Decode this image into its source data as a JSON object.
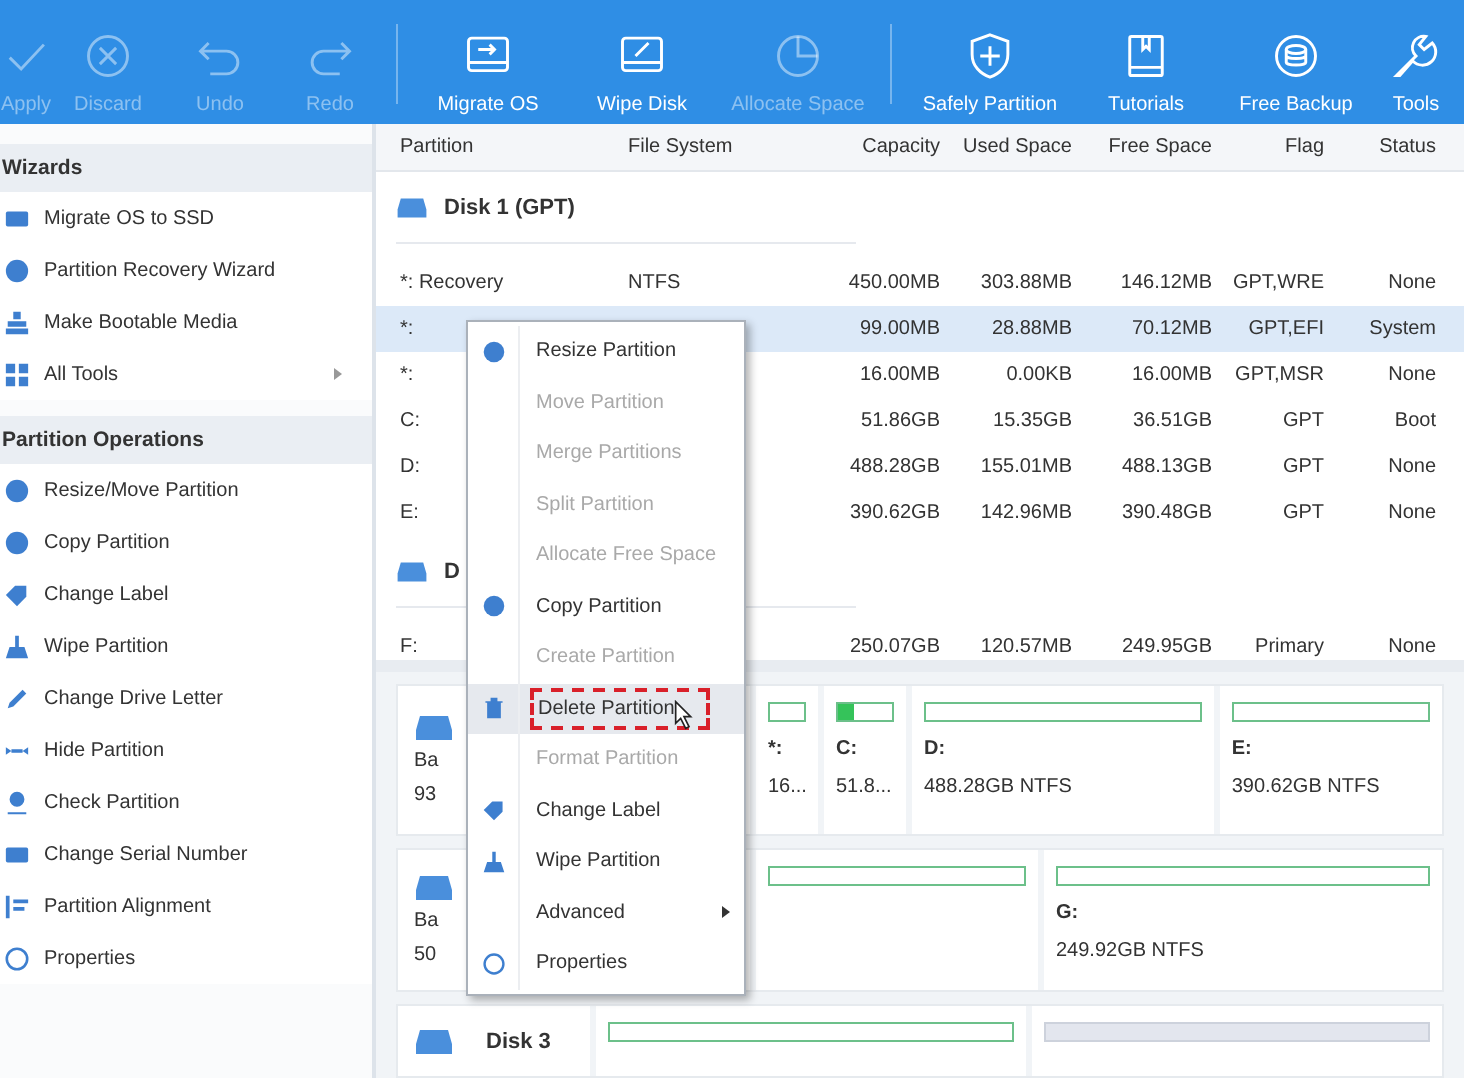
{
  "toolbar": [
    {
      "label": "Apply",
      "disabled": true
    },
    {
      "label": "Discard",
      "disabled": true
    },
    {
      "label": "Undo",
      "disabled": true
    },
    {
      "label": "Redo",
      "disabled": true
    },
    {
      "label": "Migrate OS",
      "disabled": false
    },
    {
      "label": "Wipe Disk",
      "disabled": false
    },
    {
      "label": "Allocate Space",
      "disabled": true
    },
    {
      "label": "Safely Partition",
      "disabled": false
    },
    {
      "label": "Tutorials",
      "disabled": false
    },
    {
      "label": "Free Backup",
      "disabled": false
    },
    {
      "label": "Tools",
      "disabled": false
    }
  ],
  "sidebar": [
    {
      "title": "Wizards",
      "items": [
        {
          "label": "Migrate OS to SSD",
          "submenu": false
        },
        {
          "label": "Partition Recovery Wizard",
          "submenu": false
        },
        {
          "label": "Make Bootable Media",
          "submenu": false
        },
        {
          "label": "All Tools",
          "submenu": true
        }
      ]
    },
    {
      "title": "Partition Operations",
      "items": [
        {
          "label": "Resize/Move Partition",
          "submenu": false
        },
        {
          "label": "Copy Partition",
          "submenu": false
        },
        {
          "label": "Change Label",
          "submenu": false
        },
        {
          "label": "Wipe Partition",
          "submenu": false
        },
        {
          "label": "Change Drive Letter",
          "submenu": false
        },
        {
          "label": "Hide Partition",
          "submenu": false
        },
        {
          "label": "Check Partition",
          "submenu": false
        },
        {
          "label": "Change Serial Number",
          "submenu": false
        },
        {
          "label": "Partition Alignment",
          "submenu": false
        },
        {
          "label": "Properties",
          "submenu": false
        }
      ]
    }
  ],
  "table": {
    "columns": [
      "Partition",
      "File System",
      "Capacity",
      "Used Space",
      "Free Space",
      "Flag",
      "Status"
    ],
    "disks": [
      {
        "title": "Disk 1 (GPT)",
        "rows": [
          {
            "cells": [
              "*: Recovery",
              "NTFS",
              "450.00MB",
              "303.88MB",
              "146.12MB",
              "GPT,WRE",
              "None"
            ],
            "selected": false
          },
          {
            "cells": [
              "*:",
              "",
              "99.00MB",
              "28.88MB",
              "70.12MB",
              "GPT,EFI",
              "System"
            ],
            "selected": true
          },
          {
            "cells": [
              "*:",
              "",
              "16.00MB",
              "0.00KB",
              "16.00MB",
              "GPT,MSR",
              "None"
            ],
            "selected": false
          },
          {
            "cells": [
              "C:",
              "",
              "51.86GB",
              "15.35GB",
              "36.51GB",
              "GPT",
              "Boot"
            ],
            "selected": false
          },
          {
            "cells": [
              "D:",
              "",
              "488.28GB",
              "155.01MB",
              "488.13GB",
              "GPT",
              "None"
            ],
            "selected": false
          },
          {
            "cells": [
              "E:",
              "",
              "390.62GB",
              "142.96MB",
              "390.48GB",
              "GPT",
              "None"
            ],
            "selected": false
          }
        ]
      },
      {
        "title": "D",
        "rows": [
          {
            "cells": [
              "F:",
              "",
              "250.07GB",
              "120.57MB",
              "249.95GB",
              "Primary",
              "None"
            ],
            "selected": false
          }
        ]
      }
    ]
  },
  "disk_map": [
    {
      "info": [
        "Ba",
        "93"
      ],
      "partitions": [
        {
          "label": "*:",
          "detail": "16...",
          "level": 0,
          "kind": "used"
        },
        {
          "label": "C:",
          "detail": "51.8...",
          "level": 0.3,
          "kind": "used"
        },
        {
          "label": "D:",
          "detail": "488.28GB NTFS",
          "level": 0,
          "kind": "used"
        },
        {
          "label": "E:",
          "detail": "390.62GB NTFS",
          "level": 0,
          "kind": "used"
        }
      ]
    },
    {
      "info": [
        "Ba",
        "50"
      ],
      "partitions": [
        {
          "level": 0,
          "kind": "used"
        },
        {
          "label": "G:",
          "detail": "249.92GB NTFS",
          "level": 0,
          "kind": "used"
        }
      ]
    },
    {
      "info": [
        "Disk 3"
      ],
      "partitions": [
        {
          "level": 0,
          "kind": "used"
        },
        {
          "level": 0,
          "kind": "unallocated"
        }
      ]
    }
  ],
  "context_menu": [
    {
      "label": "Resize Partition",
      "disabled": false,
      "selected": false,
      "submenu": false
    },
    {
      "label": "Move Partition",
      "disabled": true,
      "selected": false,
      "submenu": false
    },
    {
      "label": "Merge Partitions",
      "disabled": true,
      "selected": false,
      "submenu": false
    },
    {
      "label": "Split Partition",
      "disabled": true,
      "selected": false,
      "submenu": false
    },
    {
      "label": "Allocate Free Space",
      "disabled": true,
      "selected": false,
      "submenu": false
    },
    {
      "label": "Copy Partition",
      "disabled": false,
      "selected": false,
      "submenu": false
    },
    {
      "label": "Create Partition",
      "disabled": true,
      "selected": false,
      "submenu": false
    },
    {
      "label": "Delete Partition",
      "disabled": false,
      "selected": true,
      "submenu": false
    },
    {
      "label": "Format Partition",
      "disabled": true,
      "selected": false,
      "submenu": false
    },
    {
      "label": "Change Label",
      "disabled": false,
      "selected": false,
      "submenu": false
    },
    {
      "label": "Wipe Partition",
      "disabled": false,
      "selected": false,
      "submenu": false
    },
    {
      "label": "Advanced",
      "disabled": false,
      "selected": false,
      "submenu": true
    },
    {
      "label": "Properties",
      "disabled": false,
      "selected": false,
      "submenu": false
    }
  ]
}
